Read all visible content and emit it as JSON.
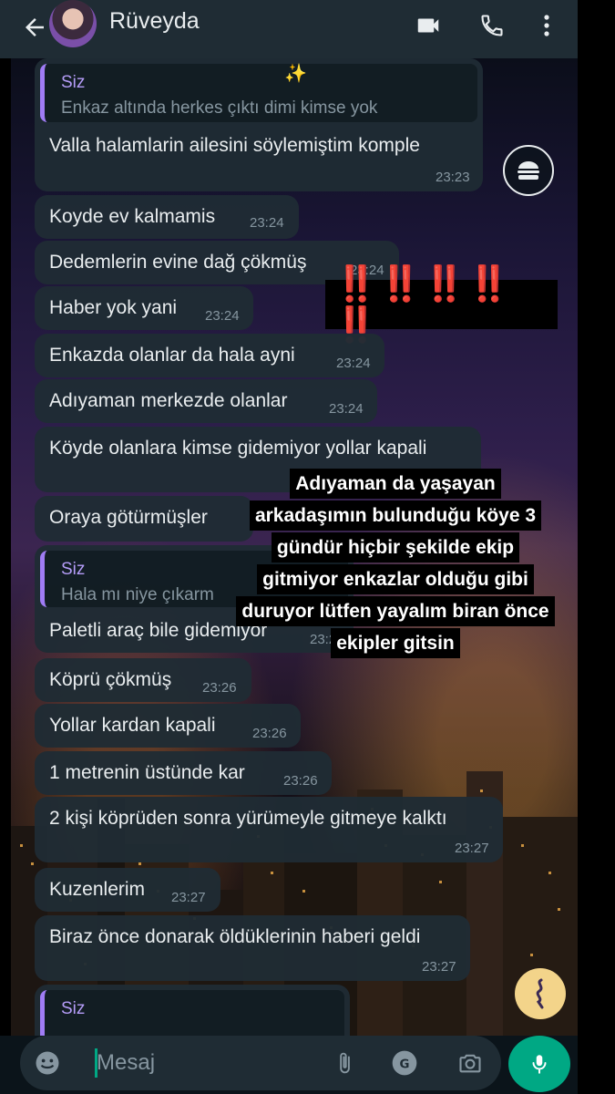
{
  "header": {
    "contact_name": "Rüveyda"
  },
  "messages": [
    {
      "quote_name": "Siz",
      "quote_text": "Enkaz altında herkes çıktı dimi kimse yok",
      "text": "Valla halamlarin ailesini söylemiştim komple",
      "time": "23:23"
    },
    {
      "text": "Koyde ev kalmamis",
      "time": "23:24"
    },
    {
      "text": "Dedemlerin evine dağ çökmüş",
      "time": "23:24"
    },
    {
      "text": "Haber yok yani",
      "time": "23:24"
    },
    {
      "text": "Enkazda olanlar da hala ayni",
      "time": "23:24"
    },
    {
      "text": "Adıyaman merkezde olanlar",
      "time": "23:24"
    },
    {
      "text": "Köyde olanlara kimse gidemiyor yollar kapali",
      "time": ""
    },
    {
      "text": "Oraya götürmüşler",
      "time": ""
    },
    {
      "quote_name": "Siz",
      "quote_text": "Hala mı niye çıkarm",
      "text": "Paletli araç bile gidemiyor",
      "time": "23:26"
    },
    {
      "text": "Köprü çökmüş",
      "time": "23:26"
    },
    {
      "text": "Yollar kardan kapali",
      "time": "23:26"
    },
    {
      "text": "1 metrenin üstünde kar",
      "time": "23:26"
    },
    {
      "text": "2 kişi köprüden sonra yürümeyle gitmeye kalktı",
      "time": "23:27"
    },
    {
      "text": "Kuzenlerim",
      "time": "23:27"
    },
    {
      "text": "Biraz önce donarak öldüklerinin haberi geldi",
      "time": "23:27"
    },
    {
      "quote_name": "Siz"
    }
  ],
  "stickers": {
    "sparkle": "✨",
    "exclamations": "‼️ ‼️ ‼️ ‼️ ‼️"
  },
  "overlay_text": [
    "Adıyaman da yaşayan",
    "arkadaşımın bulunduğu köye 3",
    "gündür hiçbir şekilde ekip",
    "gitmiyor enkazlar olduğu gibi",
    "duruyor lütfen yayalım biran önce",
    "ekipler gitsin"
  ],
  "input": {
    "placeholder": "Mesaj"
  },
  "colors": {
    "header_bg": "#1f2c34",
    "bubble_bg": "#1f2c34",
    "accent_green": "#00a884",
    "quote_purple": "#a07cf5",
    "exclamation_red": "#e51c23"
  },
  "icons": [
    "back-arrow-icon",
    "video-call-icon",
    "phone-icon",
    "more-options-icon",
    "burger-sticker-icon",
    "scroll-sticker-icon",
    "emoji-icon",
    "attach-icon",
    "translate-icon",
    "camera-icon",
    "mic-icon"
  ]
}
